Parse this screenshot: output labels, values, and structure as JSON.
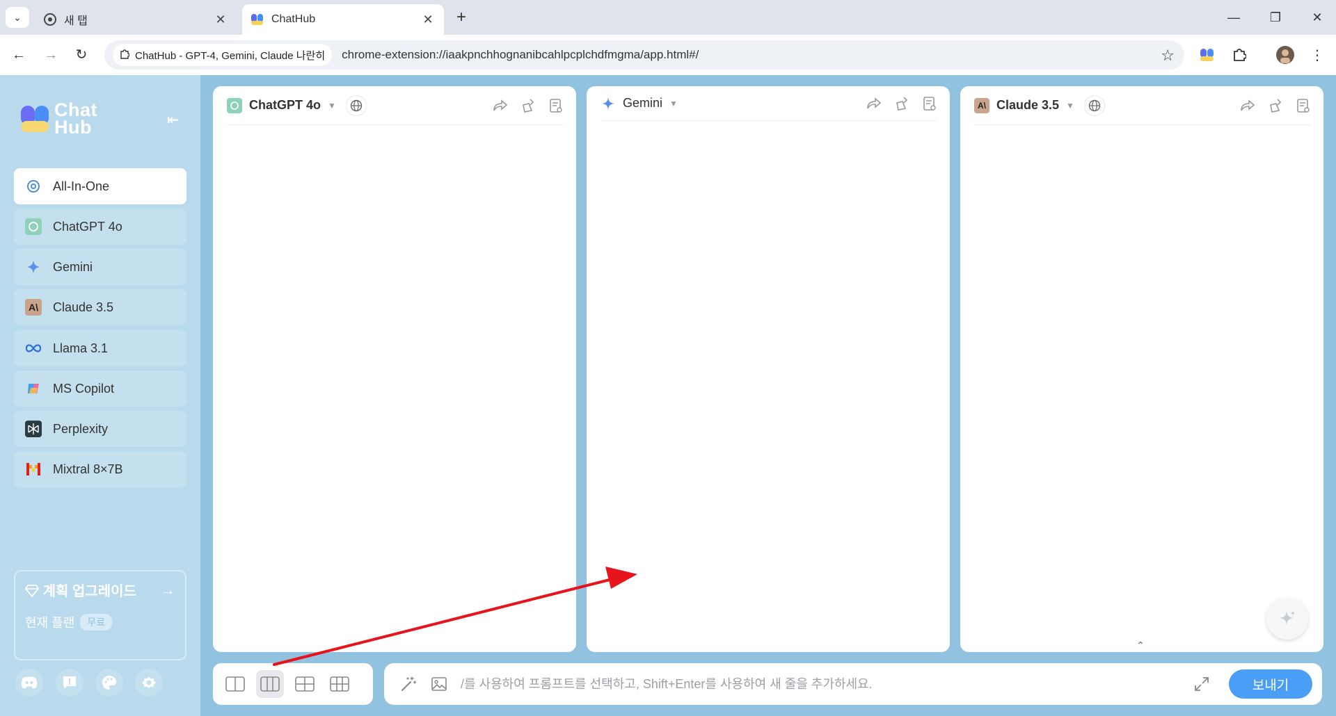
{
  "browser": {
    "tabs": [
      {
        "label": "새 탭",
        "icon": "chrome-icon"
      },
      {
        "label": "ChatHub",
        "icon": "chathub-icon"
      }
    ],
    "new_tab": "+",
    "site_chip": "ChatHub - GPT-4, Gemini, Claude 나란히",
    "url": "chrome-extension://iaakpnchhognanibcahlpcplchdfmgma/app.html#/"
  },
  "sidebar": {
    "logo_line1": "Chat",
    "logo_line2": "Hub",
    "items": [
      {
        "label": "All-In-One"
      },
      {
        "label": "ChatGPT 4o"
      },
      {
        "label": "Gemini"
      },
      {
        "label": "Claude 3.5"
      },
      {
        "label": "Llama 3.1"
      },
      {
        "label": "MS Copilot"
      },
      {
        "label": "Perplexity"
      },
      {
        "label": "Mixtral 8×7B"
      }
    ],
    "upgrade_title": "계획 업그레이드",
    "plan_label": "현재 플랜",
    "plan_badge": "무료"
  },
  "panels": [
    {
      "name": "ChatGPT 4o"
    },
    {
      "name": "Gemini"
    },
    {
      "name": "Claude 3.5"
    }
  ],
  "composer": {
    "placeholder": "/를 사용하여 프롬프트를 선택하고, Shift+Enter를 사용하여 새 줄을 추가하세요.",
    "send_label": "보내기"
  },
  "colors": {
    "app_bg": "#91c2e0",
    "sidebar_bg": "#b8daec",
    "send_button": "#4a9ef5",
    "annotation_arrow": "#e8141c"
  }
}
